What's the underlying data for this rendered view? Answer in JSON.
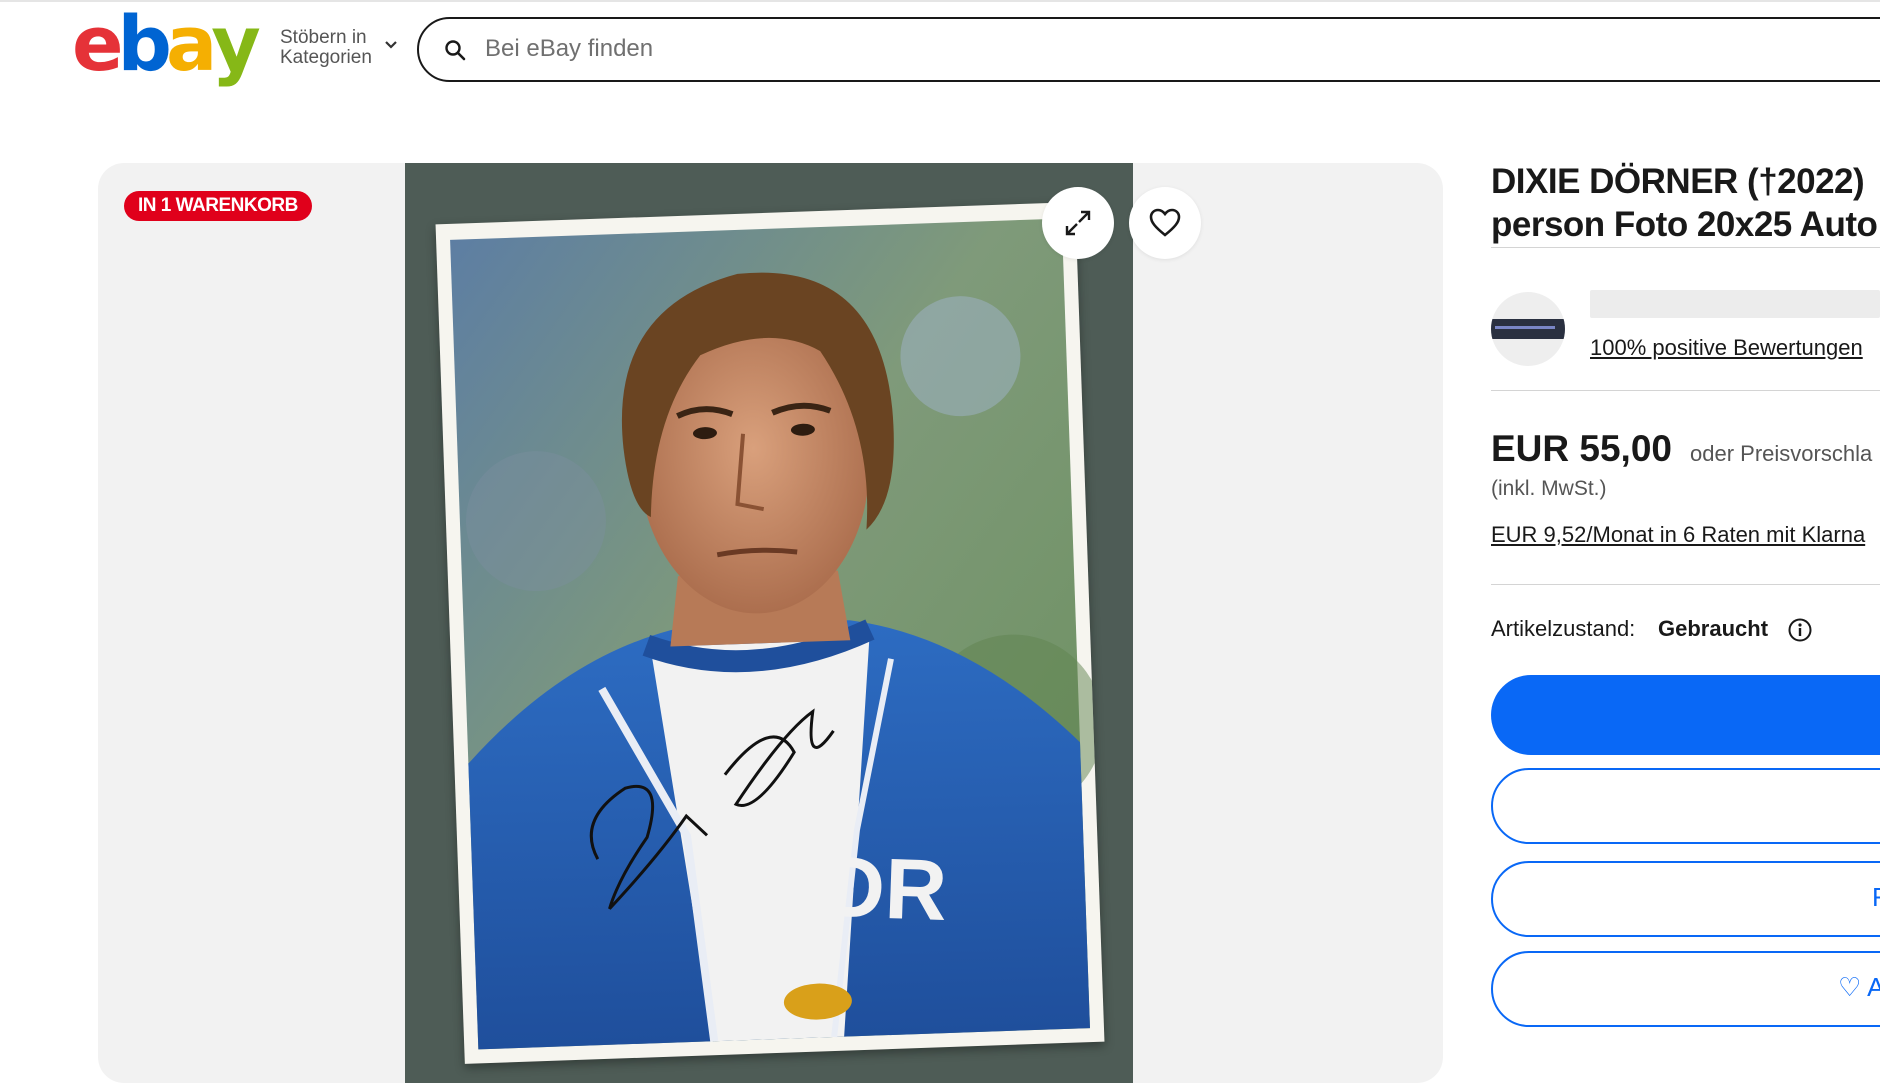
{
  "header": {
    "logo": {
      "letters": [
        "e",
        "b",
        "a",
        "y"
      ],
      "colors": [
        "#e53238",
        "#0064d2",
        "#f5af02",
        "#86b817"
      ]
    },
    "browse_line1": "Stöbern in",
    "browse_line2": "Kategorien",
    "search_placeholder": "Bei eBay finden"
  },
  "gallery": {
    "badge": "IN 1 WARENKORB",
    "photo_description_text": "DDR"
  },
  "listing": {
    "title_line1": "DIXIE DÖRNER (†2022)",
    "title_line2": "person Foto 20x25 Auto",
    "seller_feedback": "100% positive Bewertungen",
    "price": "EUR 55,00",
    "offer_text": "oder Preisvorschla",
    "tax_note": "(inkl. MwSt.)",
    "klarna": "EUR 9,52/Monat in 6 Raten mit Klarna",
    "condition_label": "Artikelzustand:",
    "condition_value": "Gebraucht",
    "watch_label": "♡ A",
    "second_button_edge": "F"
  },
  "colors": {
    "accent_blue": "#0968f6",
    "badge_red": "#e0001b"
  }
}
